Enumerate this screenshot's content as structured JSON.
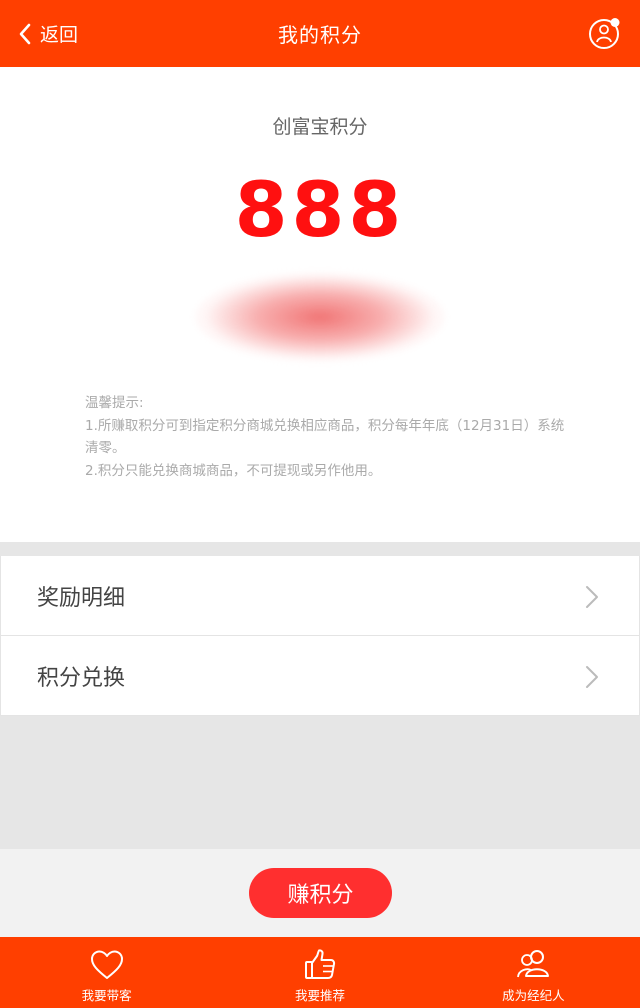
{
  "header": {
    "back_label": "返回",
    "title": "我的积分",
    "icons": {
      "back": "chevron-left-icon",
      "user": "user-icon"
    }
  },
  "points": {
    "label": "创富宝积分",
    "value": "888"
  },
  "tips": {
    "heading": "温馨提示:",
    "line1": "1.所赚取积分可到指定积分商城兑换相应商品，积分每年年底（12月31日）系统清零。",
    "line2": "2.积分只能兑换商城商品，不可提现或另作他用。"
  },
  "menu": {
    "items": [
      {
        "label": "奖励明细",
        "icon": "chevron-right-icon"
      },
      {
        "label": "积分兑换",
        "icon": "chevron-right-icon"
      }
    ]
  },
  "earn_button": "赚积分",
  "tabbar": {
    "items": [
      {
        "label": "我要带客",
        "icon": "heart-icon"
      },
      {
        "label": "我要推荐",
        "icon": "thumbs-up-icon"
      },
      {
        "label": "成为经纪人",
        "icon": "people-icon"
      }
    ]
  },
  "colors": {
    "brand": "#ff3f00",
    "points": "#ff1010",
    "earn_button": "#ff2f2f",
    "background": "#e6e6e6"
  }
}
